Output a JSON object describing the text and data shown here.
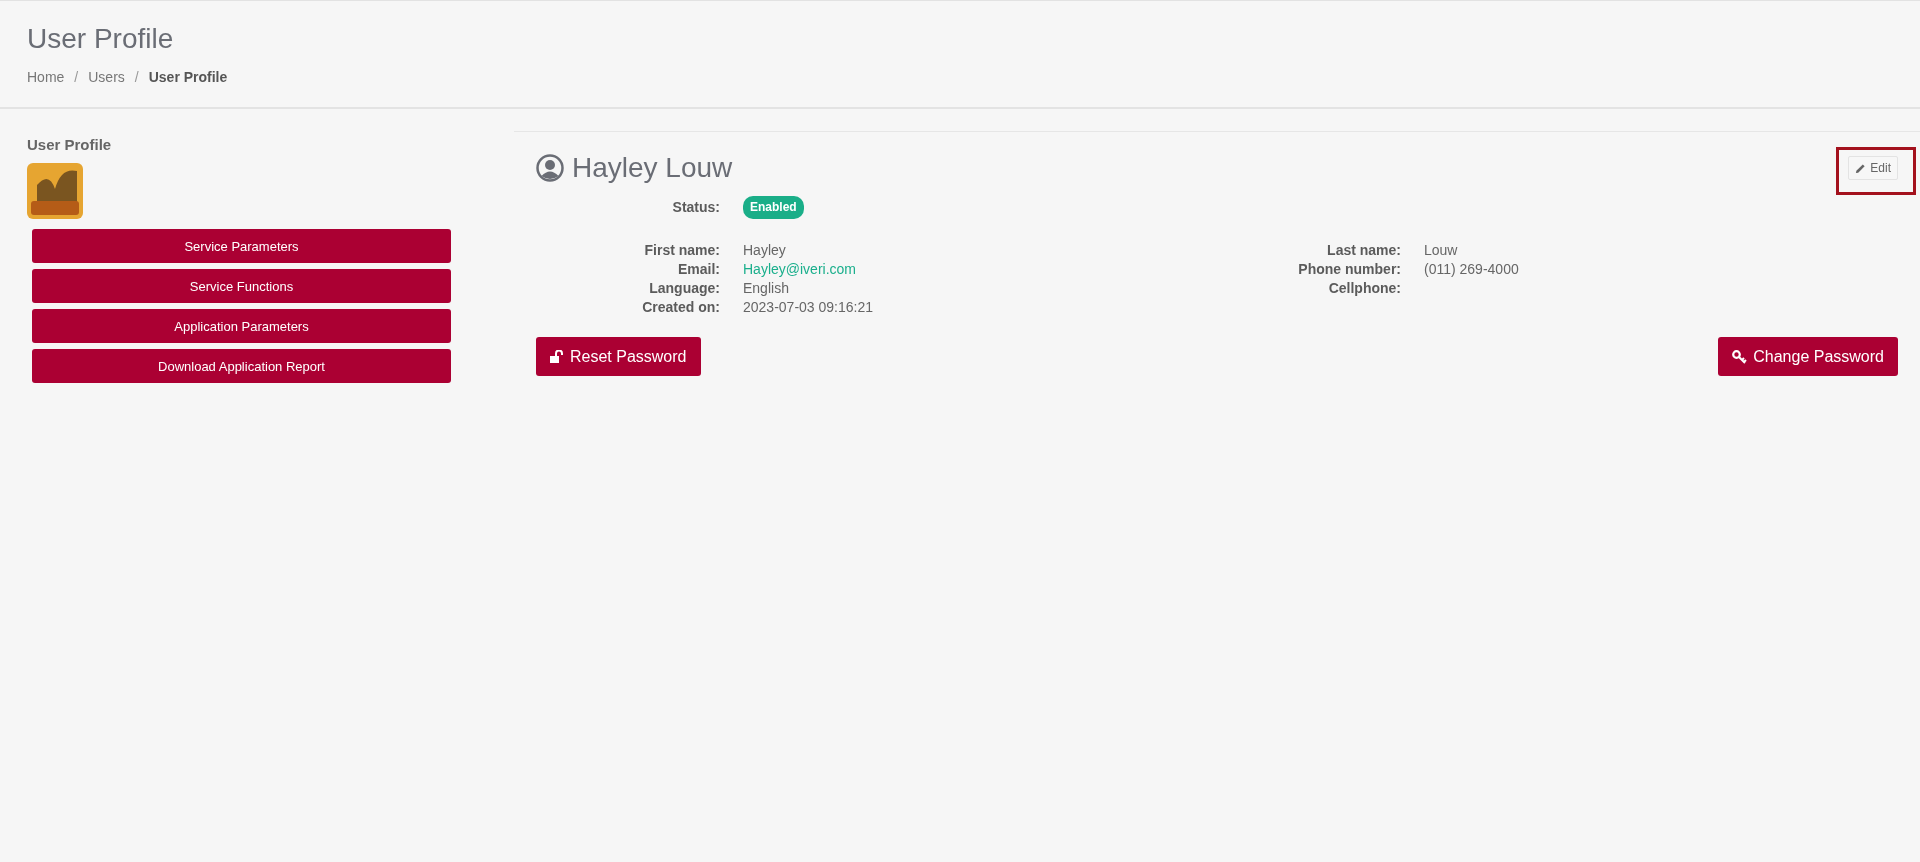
{
  "page_title": "User Profile",
  "breadcrumb": [
    {
      "label": "Home",
      "current": false
    },
    {
      "separator": "/",
      "label": "Users",
      "current": false
    },
    {
      "separator": "/",
      "label": "User Profile",
      "current": true
    }
  ],
  "sidebar": {
    "title": "User Profile",
    "buttons": [
      "Service Parameters",
      "Service Functions",
      "Application Parameters",
      "Download Application Report"
    ]
  },
  "profile": {
    "name": "Hayley Louw",
    "edit_button": "Edit",
    "edit_highlighted": true,
    "status_label": "Status:",
    "status": "Enabled",
    "left_fields": [
      {
        "label": "First name:",
        "value": "Hayley",
        "kind": "text"
      },
      {
        "label": "Email:",
        "value": "Hayley@iveri.com",
        "kind": "link"
      },
      {
        "label": "Language:",
        "value": "English",
        "kind": "text"
      },
      {
        "label": "Created on:",
        "value": "2023-07-03 09:16:21",
        "kind": "text"
      }
    ],
    "right_fields": [
      {
        "label": "Last name:",
        "value": "Louw"
      },
      {
        "label": "Phone number:",
        "value": "(011) 269-4000"
      },
      {
        "label": "Cellphone:"
      }
    ],
    "reset_button": "Reset Password",
    "change_button": "Change Password"
  }
}
